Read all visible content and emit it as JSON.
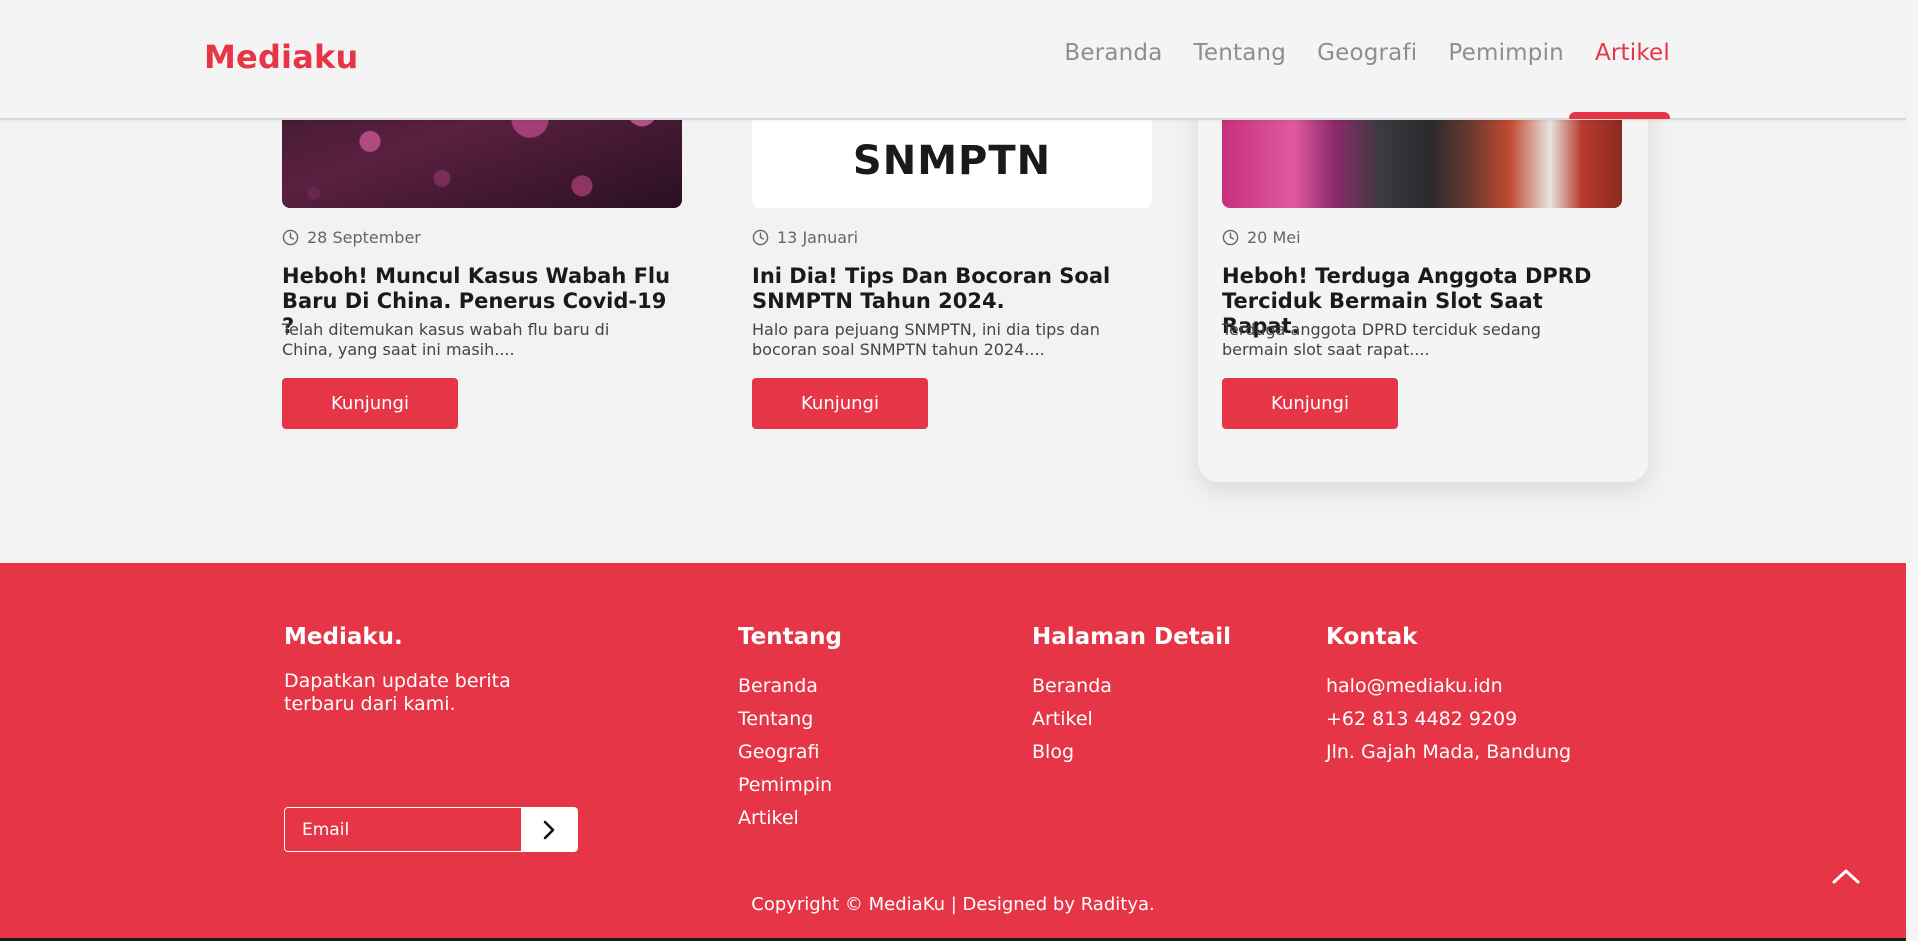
{
  "header": {
    "brand": "Mediaku",
    "nav": [
      "Beranda",
      "Tentang",
      "Geografi",
      "Pemimpin",
      "Artikel"
    ],
    "active": "Artikel"
  },
  "articles": [
    {
      "date": "28 September",
      "title": "Heboh! Muncul Kasus Wabah Flu Baru Di China. Penerus Covid-19 ?",
      "desc": "Telah ditemukan kasus wabah flu baru di China, yang saat ini masih....",
      "button": "Kunjungi"
    },
    {
      "date": "13 Januari",
      "title": "Ini Dia! Tips Dan Bocoran Soal SNMPTN Tahun 2024.",
      "desc": "Halo para pejuang SNMPTN, ini dia tips dan bocoran soal SNMPTN tahun 2024....",
      "button": "Kunjungi",
      "image_text": "SNMPTN"
    },
    {
      "date": "20 Mei",
      "title": "Heboh! Terduga Anggota DPRD Terciduk Bermain Slot Saat Rapat.",
      "desc": "Terduga anggota DPRD terciduk sedang bermain slot saat rapat....",
      "button": "Kunjungi"
    }
  ],
  "footer": {
    "brand": "Mediaku.",
    "tagline": "Dapatkan update berita terbaru dari kami.",
    "email_placeholder": "Email",
    "about": {
      "heading": "Tentang",
      "links": [
        "Beranda",
        "Tentang",
        "Geografi",
        "Pemimpin",
        "Artikel"
      ]
    },
    "detail": {
      "heading": "Halaman Detail",
      "links": [
        "Beranda",
        "Artikel",
        "Blog"
      ]
    },
    "contact": {
      "heading": "Kontak",
      "items": [
        "halo@mediaku.idn",
        "+62 813 4482 9209",
        "Jln. Gajah Mada, Bandung"
      ]
    },
    "copyright": "Copyright © MediaKu | Designed by Raditya."
  },
  "colors": {
    "accent": "#e63546",
    "background": "#f2f2f2",
    "header": "#f4f4f4"
  },
  "icons": [
    "clock-icon",
    "chevron-right-icon",
    "chevron-up-icon"
  ]
}
